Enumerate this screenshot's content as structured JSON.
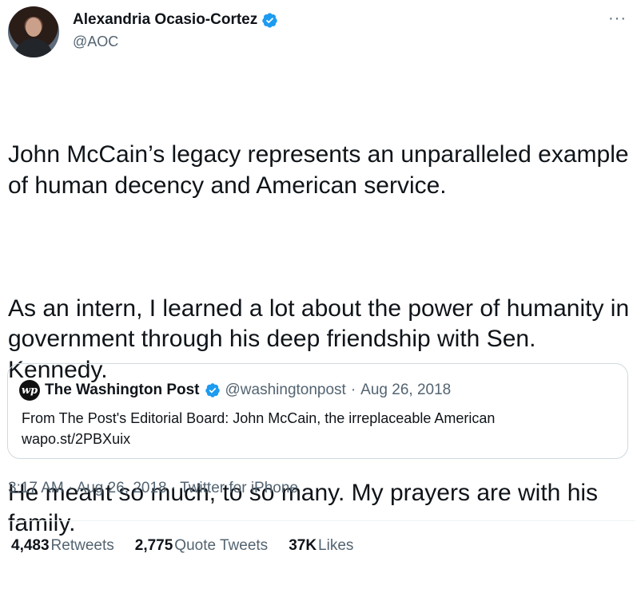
{
  "author": {
    "name": "Alexandria Ocasio-Cortez",
    "handle": "@AOC"
  },
  "more_glyph": "···",
  "tweet": {
    "paragraphs": [
      "John McCain’s legacy represents an unparalleled example of human decency and American service.",
      "As an intern, I learned a lot about the power of humanity in government through his deep friendship with Sen. Kennedy.",
      "He meant so much, to so many. My prayers are with his family."
    ]
  },
  "quoted": {
    "logo_text": "wp",
    "name": "The Washington Post",
    "handle": "@washingtonpost",
    "separator": "·",
    "date": "Aug 26, 2018",
    "line1": "From The Post's Editorial Board: John McCain, the irreplaceable American",
    "line2": "wapo.st/2PBXuix"
  },
  "meta": {
    "time": "3:17 AM",
    "sep": "·",
    "date": "Aug 26, 2018",
    "source": "Twitter for iPhone"
  },
  "stats": {
    "retweets_count": "4,483",
    "retweets_label": "Retweets",
    "quotes_count": "2,775",
    "quotes_label": "Quote Tweets",
    "likes_count": "37K",
    "likes_label": "Likes"
  },
  "colors": {
    "verified": "#1d9bf0",
    "secondary_text": "#536471",
    "border": "#cfd9de"
  }
}
